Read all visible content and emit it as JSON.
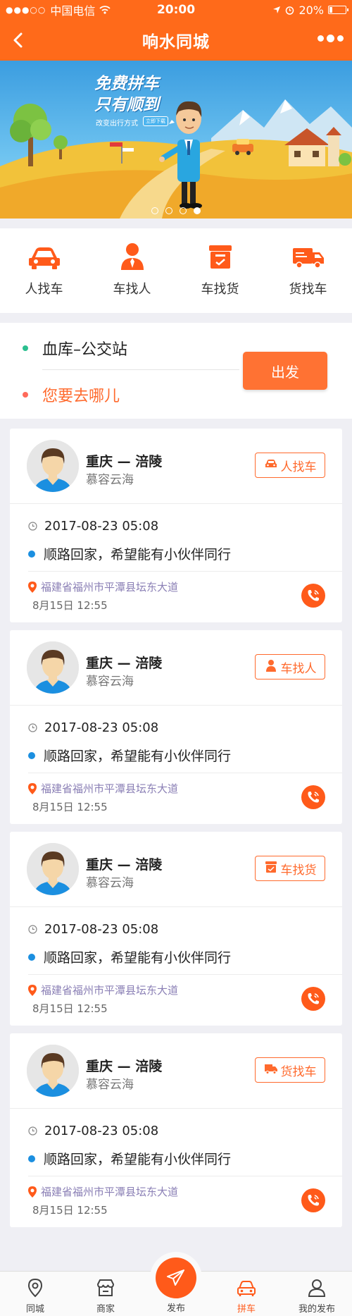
{
  "statusbar": {
    "carrier": "中国电信",
    "time": "20:00",
    "battery_percent": "20%",
    "battery_level": 0.2
  },
  "navbar": {
    "title": "响水同城"
  },
  "banner": {
    "headline_1": "免费拼车",
    "headline_2": "只有顺到",
    "subline": "改变出行方式",
    "tag": "立即下载",
    "page_count": 4,
    "active_page": 4
  },
  "categories": [
    {
      "label": "人找车",
      "icon": "car-icon"
    },
    {
      "label": "车找人",
      "icon": "person-icon"
    },
    {
      "label": "车找货",
      "icon": "cargo-box-icon"
    },
    {
      "label": "货找车",
      "icon": "truck-icon"
    }
  ],
  "route": {
    "from": "血库–公交站",
    "to_placeholder": "您要去哪儿",
    "go_label": "出发"
  },
  "colors": {
    "brand": "#ff6a1a",
    "accent": "#ff5a1a",
    "dot_from": "#2bbf8f",
    "dot_to": "#ff6a5a",
    "info_dot": "#1b8fe0"
  },
  "posts": [
    {
      "route": "重庆 — 涪陵",
      "name": "慕容云海",
      "tag": "人找车",
      "tag_icon": "car-icon",
      "datetime": "2017-08-23 05:08",
      "message": "顺路回家，希望能有小伙伴同行",
      "address": "福建省福州市平潭县坛东大道",
      "time": "8月15日 12:55"
    },
    {
      "route": "重庆 — 涪陵",
      "name": "慕容云海",
      "tag": "车找人",
      "tag_icon": "person-icon",
      "datetime": "2017-08-23 05:08",
      "message": "顺路回家，希望能有小伙伴同行",
      "address": "福建省福州市平潭县坛东大道",
      "time": "8月15日 12:55"
    },
    {
      "route": "重庆 — 涪陵",
      "name": "慕容云海",
      "tag": "车找货",
      "tag_icon": "cargo-box-icon",
      "datetime": "2017-08-23 05:08",
      "message": "顺路回家，希望能有小伙伴同行",
      "address": "福建省福州市平潭县坛东大道",
      "time": "8月15日 12:55"
    },
    {
      "route": "重庆 — 涪陵",
      "name": "慕容云海",
      "tag": "货找车",
      "tag_icon": "truck-icon",
      "datetime": "2017-08-23 05:08",
      "message": "顺路回家，希望能有小伙伴同行",
      "address": "福建省福州市平潭县坛东大道",
      "time": "8月15日 12:55"
    }
  ],
  "tabbar": {
    "items": [
      {
        "label": "同城",
        "icon": "location-pin-icon"
      },
      {
        "label": "商家",
        "icon": "shop-icon"
      },
      {
        "label": "发布",
        "icon": "paper-plane-icon"
      },
      {
        "label": "拼车",
        "icon": "car-icon",
        "active": true
      },
      {
        "label": "我的发布",
        "icon": "user-icon"
      }
    ]
  }
}
